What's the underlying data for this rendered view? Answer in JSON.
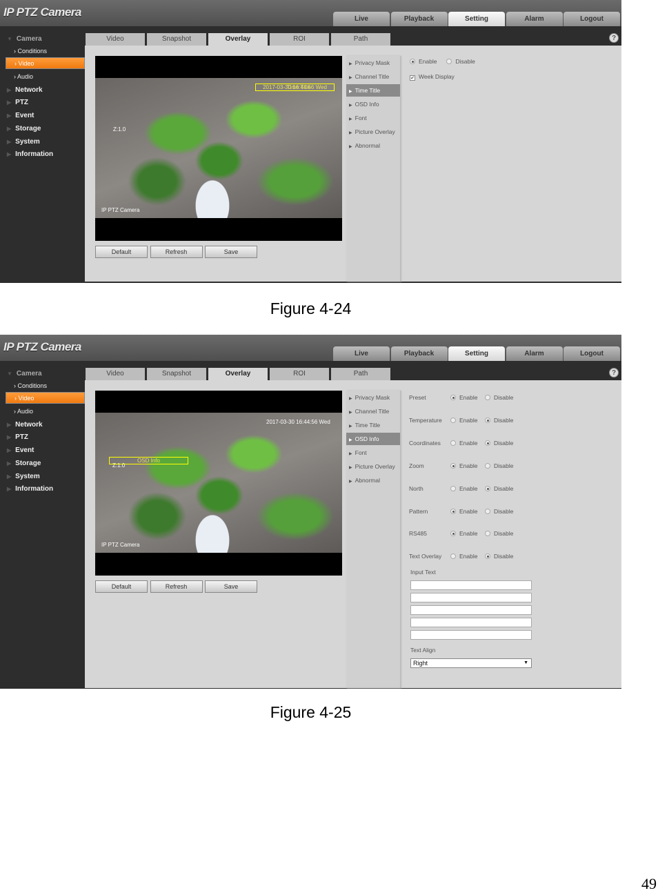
{
  "figures": [
    {
      "caption": "Figure 4-24",
      "app_title": "IP PTZ Camera",
      "top_nav": [
        "Live",
        "Playback",
        "Setting",
        "Alarm",
        "Logout"
      ],
      "top_nav_active": 2,
      "sidebar": [
        {
          "label": "Camera",
          "kind": "top"
        },
        {
          "label": "Conditions",
          "kind": "sub"
        },
        {
          "label": "Video",
          "kind": "sub",
          "selected": true
        },
        {
          "label": "Audio",
          "kind": "sub"
        },
        {
          "label": "Network",
          "kind": "main"
        },
        {
          "label": "PTZ",
          "kind": "main"
        },
        {
          "label": "Event",
          "kind": "main"
        },
        {
          "label": "Storage",
          "kind": "main"
        },
        {
          "label": "System",
          "kind": "main"
        },
        {
          "label": "Information",
          "kind": "main"
        }
      ],
      "tabs": [
        "Video",
        "Snapshot",
        "Overlay",
        "ROI",
        "Path"
      ],
      "tabs_active": 2,
      "help_icon": "?",
      "video_overlay": {
        "time": "2017-03-30 16:44:56 Wed",
        "time_box_label": "Time Title",
        "zoom": "Z:1.0",
        "channel": "IP PTZ Camera",
        "highlight": "time"
      },
      "buttons": [
        "Default",
        "Refresh",
        "Save"
      ],
      "menu": [
        "Privacy Mask",
        "Channel Title",
        "Time Title",
        "OSD Info",
        "Font",
        "Picture Overlay",
        "Abnormal"
      ],
      "menu_active": 2,
      "time_title": {
        "enable_label": "Enable",
        "disable_label": "Disable",
        "value": "Enable",
        "week_display_label": "Week Display",
        "week_display": true
      }
    },
    {
      "caption": "Figure 4-25",
      "app_title": "IP PTZ Camera",
      "top_nav": [
        "Live",
        "Playback",
        "Setting",
        "Alarm",
        "Logout"
      ],
      "top_nav_active": 2,
      "sidebar": [
        {
          "label": "Camera",
          "kind": "top"
        },
        {
          "label": "Conditions",
          "kind": "sub"
        },
        {
          "label": "Video",
          "kind": "sub",
          "selected": true
        },
        {
          "label": "Audio",
          "kind": "sub"
        },
        {
          "label": "Network",
          "kind": "main"
        },
        {
          "label": "PTZ",
          "kind": "main"
        },
        {
          "label": "Event",
          "kind": "main"
        },
        {
          "label": "Storage",
          "kind": "main"
        },
        {
          "label": "System",
          "kind": "main"
        },
        {
          "label": "Information",
          "kind": "main"
        }
      ],
      "tabs": [
        "Video",
        "Snapshot",
        "Overlay",
        "ROI",
        "Path"
      ],
      "tabs_active": 2,
      "help_icon": "?",
      "video_overlay": {
        "time": "2017-03-30 16:44:56 Wed",
        "osd_box_label": "OSD Info",
        "zoom": "Z:1.0",
        "channel": "IP PTZ Camera",
        "highlight": "osd"
      },
      "buttons": [
        "Default",
        "Refresh",
        "Save"
      ],
      "menu": [
        "Privacy Mask",
        "Channel Title",
        "Time Title",
        "OSD Info",
        "Font",
        "Picture Overlay",
        "Abnormal"
      ],
      "menu_active": 3,
      "osd_info": {
        "enable_label": "Enable",
        "disable_label": "Disable",
        "rows": [
          {
            "label": "Preset",
            "value": "Enable"
          },
          {
            "label": "Temperature",
            "value": "Disable"
          },
          {
            "label": "Coordinates",
            "value": "Disable"
          },
          {
            "label": "Zoom",
            "value": "Enable"
          },
          {
            "label": "North",
            "value": "Disable"
          },
          {
            "label": "Pattern",
            "value": "Enable"
          },
          {
            "label": "RS485",
            "value": "Enable"
          },
          {
            "label": "Text Overlay",
            "value": "Disable"
          }
        ],
        "input_text_label": "Input Text",
        "input_texts": [
          "",
          "",
          "",
          "",
          ""
        ],
        "text_align_label": "Text Align",
        "text_align": "Right"
      }
    }
  ],
  "page_number": "49"
}
